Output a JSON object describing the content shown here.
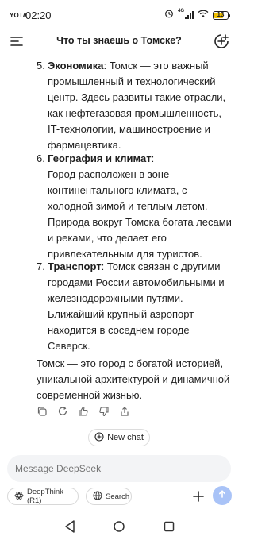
{
  "status_bar": {
    "carrier": "YOTA",
    "time": "02:20",
    "network": "4G",
    "battery_level": "13",
    "battery_color": "#f0c000"
  },
  "header": {
    "title": "Что ты знаешь о Томске?",
    "menu_icon": "menu-icon",
    "new_chat_icon": "plus-circle-icon"
  },
  "message": {
    "items": [
      {
        "number": "5.",
        "heading": "Экономика",
        "text": ": Томск — это важный промышленный и технологический центр. Здесь развиты такие отрасли, как нефтегазовая промышленность, IT-технологии, машиностроение и фармацевтика."
      },
      {
        "number": "6.",
        "heading": "География и климат",
        "text": ":",
        "text2": "Город расположен в зоне континентального климата, с холодной зимой и теплым летом. Природа вокруг Томска богата лесами и реками, что делает его привлекательным для туристов."
      },
      {
        "number": "7.",
        "heading": "Транспорт",
        "text": ": Томск связан с другими городами России автомобильными и железнодорожными путями. Ближайший крупный аэропорт находится в соседнем городе Северск."
      }
    ],
    "conclusion": "Томск — это город с богатой историей, уникальной архитектурой и динамичной современной жизнью."
  },
  "actions": [
    "copy-icon",
    "regenerate-icon",
    "thumbs-up-icon",
    "thumbs-down-icon",
    "share-icon"
  ],
  "new_chat_button": {
    "label": "New chat"
  },
  "composer": {
    "placeholder": "Message DeepSeek",
    "deepthink_label": "DeepThink (R1)",
    "search_label": "Search",
    "send_color": "#a9c3f7"
  }
}
